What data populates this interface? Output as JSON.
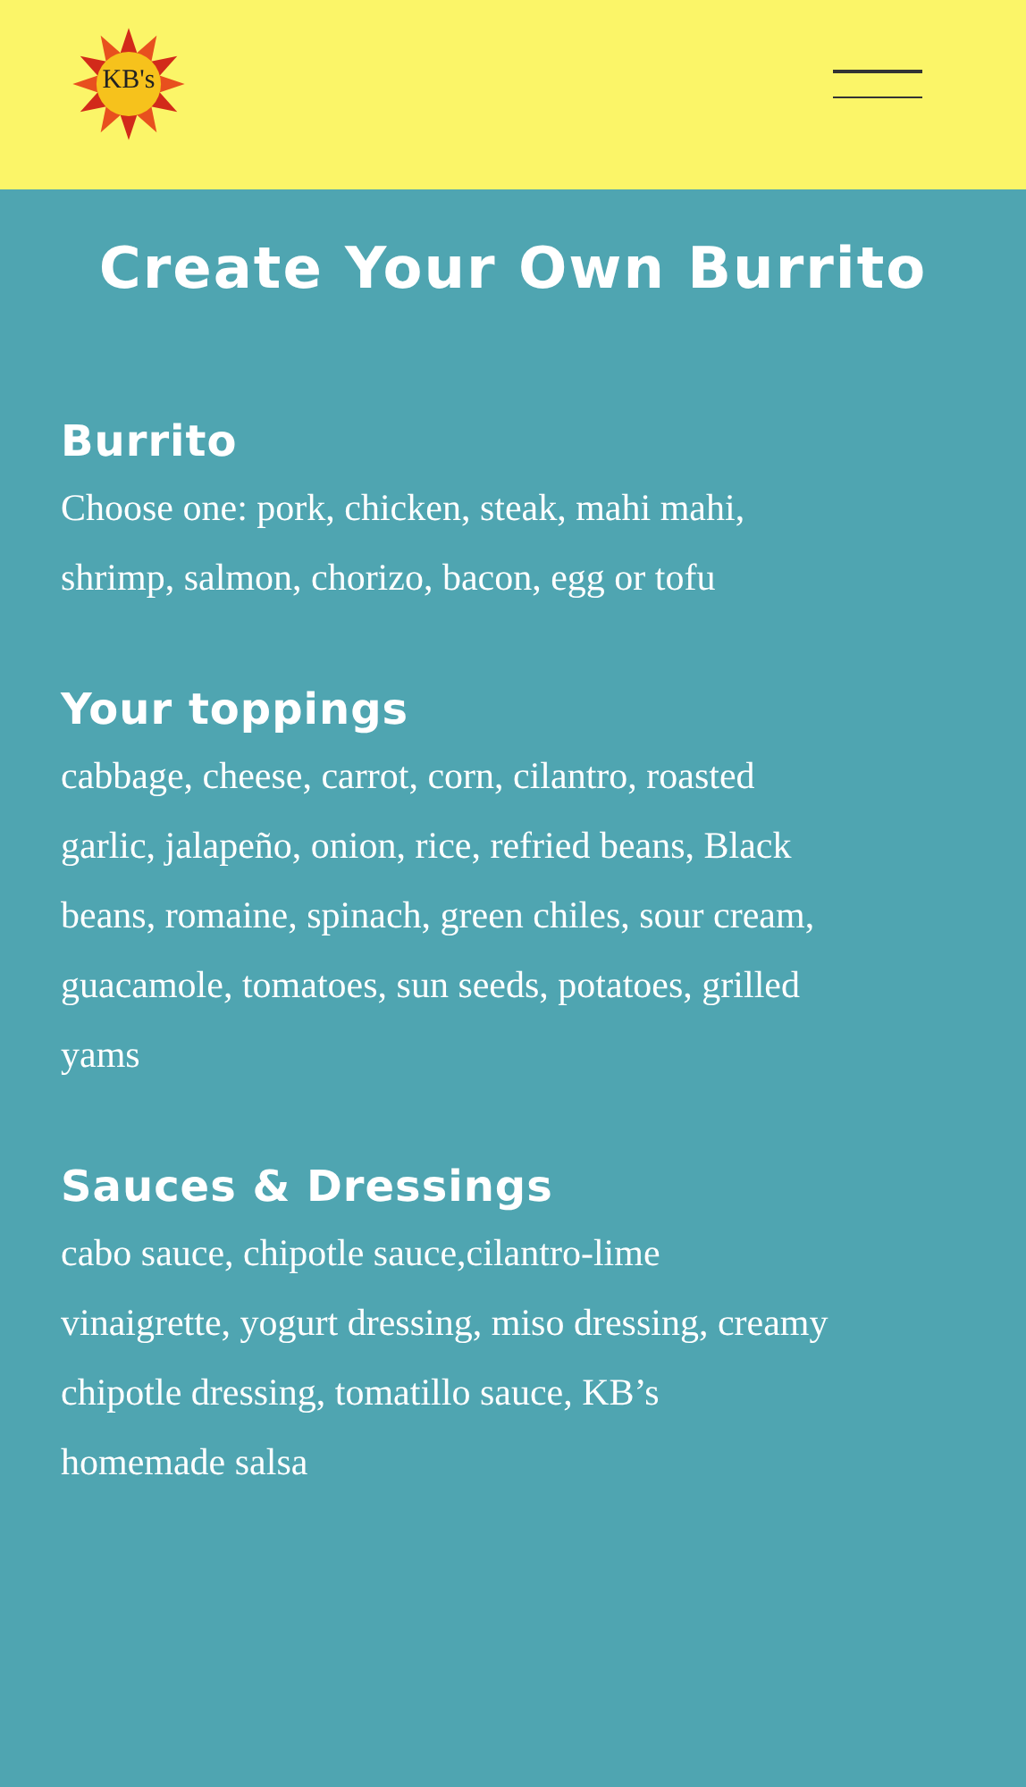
{
  "header": {
    "logo_text": "KB's"
  },
  "title": "Create Your Own Burrito",
  "sections": [
    {
      "heading": "Burrito",
      "text": "Choose one: pork, chicken, steak, mahi mahi, shrimp, salmon, chorizo, bacon, egg or tofu"
    },
    {
      "heading": "Your toppings",
      "text": "cabbage, cheese, carrot, corn, cilantro, roasted garlic, jalapeño, onion, rice, refried beans, Black beans, romaine, spinach, green chiles, sour cream, guacamole, tomatoes, sun seeds, potatoes, grilled yams"
    },
    {
      "heading": "Sauces & Dressings",
      "text": "cabo sauce, chipotle sauce,cilantro-lime vinaigrette, yogurt dressing, miso dressing, creamy chipotle dressing, tomatillo sauce, KB’s homemade salsa"
    }
  ]
}
